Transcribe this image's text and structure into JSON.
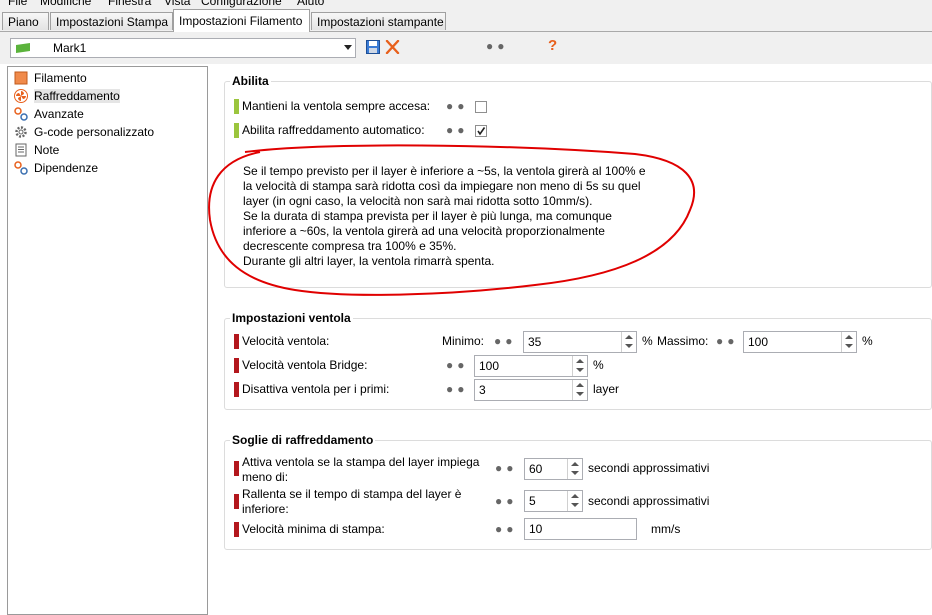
{
  "menubar": [
    "File",
    "Modifiche",
    "Finestra",
    "Vista",
    "Configurazione",
    "Aiuto"
  ],
  "tabs": [
    {
      "label": "Piano",
      "active": false
    },
    {
      "label": "Impostazioni Stampa",
      "active": false
    },
    {
      "label": "Impostazioni Filamento",
      "active": true
    },
    {
      "label": "Impostazioni stampante",
      "active": false
    }
  ],
  "profile": {
    "name": "Mark1",
    "flag_color": "#5bb33c",
    "save_icon": "save-icon",
    "delete_icon": "delete-icon",
    "help_label": "?"
  },
  "tree": [
    {
      "label": "Filamento",
      "icon": "filament-icon",
      "selected": false
    },
    {
      "label": "Raffreddamento",
      "icon": "fan-icon",
      "selected": true
    },
    {
      "label": "Avanzate",
      "icon": "advanced-icon",
      "selected": false
    },
    {
      "label": "G-code personalizzato",
      "icon": "gear-icon",
      "selected": false
    },
    {
      "label": "Note",
      "icon": "note-icon",
      "selected": false
    },
    {
      "label": "Dipendenze",
      "icon": "dependencies-icon",
      "selected": false
    }
  ],
  "abilita": {
    "title": "Abilita",
    "fan_always_on": {
      "label": "Mantieni la ventola sempre accesa:",
      "checked": false
    },
    "auto_cooling": {
      "label": "Abilita raffreddamento automatico:",
      "checked": true
    },
    "description": [
      "Se il tempo previsto per il layer è inferiore a ~5s, la ventola girerà al 100% e",
      "la velocità di stampa sarà ridotta così da impiegare non meno di 5s su quel",
      "layer (in ogni caso, la velocità non sarà mai ridotta sotto 10mm/s).",
      "Se la durata di stampa prevista per il layer è più lunga, ma comunque",
      "inferiore a ~60s, la ventola girerà ad una velocità proporzionalmente",
      "decrescente compresa tra 100% e 35%.",
      "Durante gli altri layer, la ventola rimarrà spenta."
    ]
  },
  "ventola": {
    "title": "Impostazioni ventola",
    "fan_speed": {
      "label": "Velocità ventola:",
      "min_label": "Minimo:",
      "min_value": "35",
      "max_label": "Massimo:",
      "max_value": "100",
      "unit": "%"
    },
    "bridge": {
      "label": "Velocità ventola Bridge:",
      "value": "100",
      "unit": "%"
    },
    "disable_first": {
      "label": "Disattiva ventola per i primi:",
      "value": "3",
      "unit": "layer"
    }
  },
  "soglie": {
    "title": "Soglie di raffreddamento",
    "fan_below": {
      "label_line1": "Attiva ventola se la stampa del layer impiega",
      "label_line2": "meno di:",
      "value": "60",
      "unit": "secondi approssimativi"
    },
    "slow_down": {
      "label_line1": "Rallenta se il tempo di stampa del layer è",
      "label_line2": "inferiore:",
      "value": "5",
      "unit": "secondi approssimativi"
    },
    "min_speed": {
      "label": "Velocità minima di stampa:",
      "value": "10",
      "unit": "mm/s"
    }
  },
  "colors": {
    "accent_red": "#b3171d",
    "accent_green": "#9bc53d",
    "annotation_red": "#e00000",
    "delete_orange": "#e8601c"
  }
}
